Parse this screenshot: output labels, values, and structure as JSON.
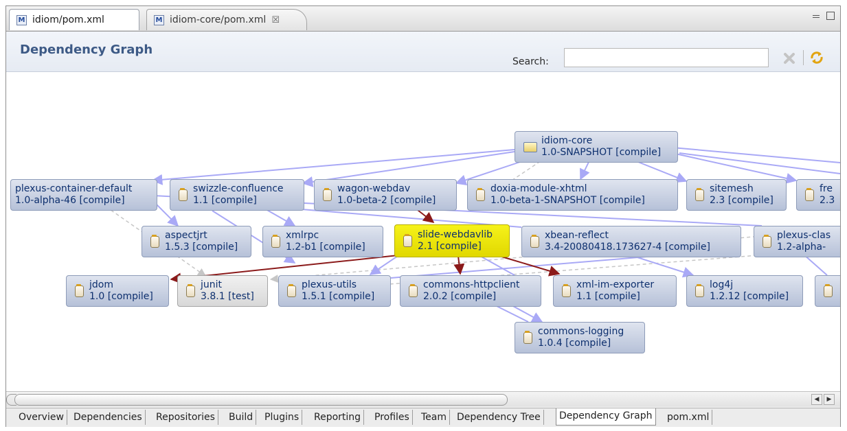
{
  "editor_tabs": [
    {
      "label": "idiom/pom.xml",
      "icon": "maven-pom-icon"
    },
    {
      "label": "idiom-core/pom.xml",
      "icon": "maven-pom-icon",
      "close": "☒"
    }
  ],
  "header": {
    "title": "Dependency Graph",
    "search_label": "Search:",
    "search_value": ""
  },
  "nodes": [
    {
      "id": "idiom-core",
      "name": "idiom-core",
      "version": "1.0-SNAPSHOT [compile]",
      "icon": "folder-icon",
      "state": "root"
    },
    {
      "id": "plexus-container-default",
      "name": "plexus-container-default",
      "version": "1.0-alpha-46 [compile]",
      "icon": "jar-icon"
    },
    {
      "id": "swizzle-confluence",
      "name": "swizzle-confluence",
      "version": "1.1 [compile]",
      "icon": "jar-icon"
    },
    {
      "id": "wagon-webdav",
      "name": "wagon-webdav",
      "version": "1.0-beta-2 [compile]",
      "icon": "jar-icon"
    },
    {
      "id": "doxia-module-xhtml",
      "name": "doxia-module-xhtml",
      "version": "1.0-beta-1-SNAPSHOT [compile]",
      "icon": "jar-icon"
    },
    {
      "id": "sitemesh",
      "name": "sitemesh",
      "version": "2.3 [compile]",
      "icon": "jar-icon"
    },
    {
      "id": "fre",
      "name": "fre",
      "version": "2.3",
      "icon": "jar-icon"
    },
    {
      "id": "aspectjrt",
      "name": "aspectjrt",
      "version": "1.5.3 [compile]",
      "icon": "jar-icon"
    },
    {
      "id": "xmlrpc",
      "name": "xmlrpc",
      "version": "1.2-b1 [compile]",
      "icon": "jar-icon"
    },
    {
      "id": "slide-webdavlib",
      "name": "slide-webdavlib",
      "version": "2.1 [compile]",
      "icon": "jar-icon",
      "state": "selected"
    },
    {
      "id": "xbean-reflect",
      "name": "xbean-reflect",
      "version": "3.4-20080418.173627-4 [compile]",
      "icon": "jar-icon"
    },
    {
      "id": "plexus-clas",
      "name": "plexus-clas",
      "version": "1.2-alpha-",
      "icon": "jar-icon"
    },
    {
      "id": "jdom",
      "name": "jdom",
      "version": "1.0 [compile]",
      "icon": "jar-icon"
    },
    {
      "id": "junit",
      "name": "junit",
      "version": "3.8.1 [test]",
      "icon": "jar-icon",
      "state": "test"
    },
    {
      "id": "plexus-utils",
      "name": "plexus-utils",
      "version": "1.5.1 [compile]",
      "icon": "jar-icon"
    },
    {
      "id": "commons-httpclient",
      "name": "commons-httpclient",
      "version": "2.0.2 [compile]",
      "icon": "jar-icon"
    },
    {
      "id": "xml-im-exporter",
      "name": "xml-im-exporter",
      "version": "1.1 [compile]",
      "icon": "jar-icon"
    },
    {
      "id": "log4j",
      "name": "log4j",
      "version": "1.2.12 [compile]",
      "icon": "jar-icon"
    },
    {
      "id": "commons-logging",
      "name": "commons-logging",
      "version": "1.0.4 [compile]",
      "icon": "jar-icon"
    },
    {
      "id": "cut-off",
      "name": "",
      "version": "",
      "icon": "jar-icon"
    }
  ],
  "edge_colors": {
    "normal": "#a9a9f6",
    "highlight": "#8b1a1a",
    "test": "#c6c6c6"
  },
  "bottom_tabs": [
    "Overview",
    "Dependencies",
    "Repositories",
    "Build",
    "Plugins",
    "Reporting",
    "Profiles",
    "Team",
    "Dependency Tree",
    "Dependency Graph",
    "pom.xml"
  ],
  "active_bottom_tab": "Dependency Graph"
}
